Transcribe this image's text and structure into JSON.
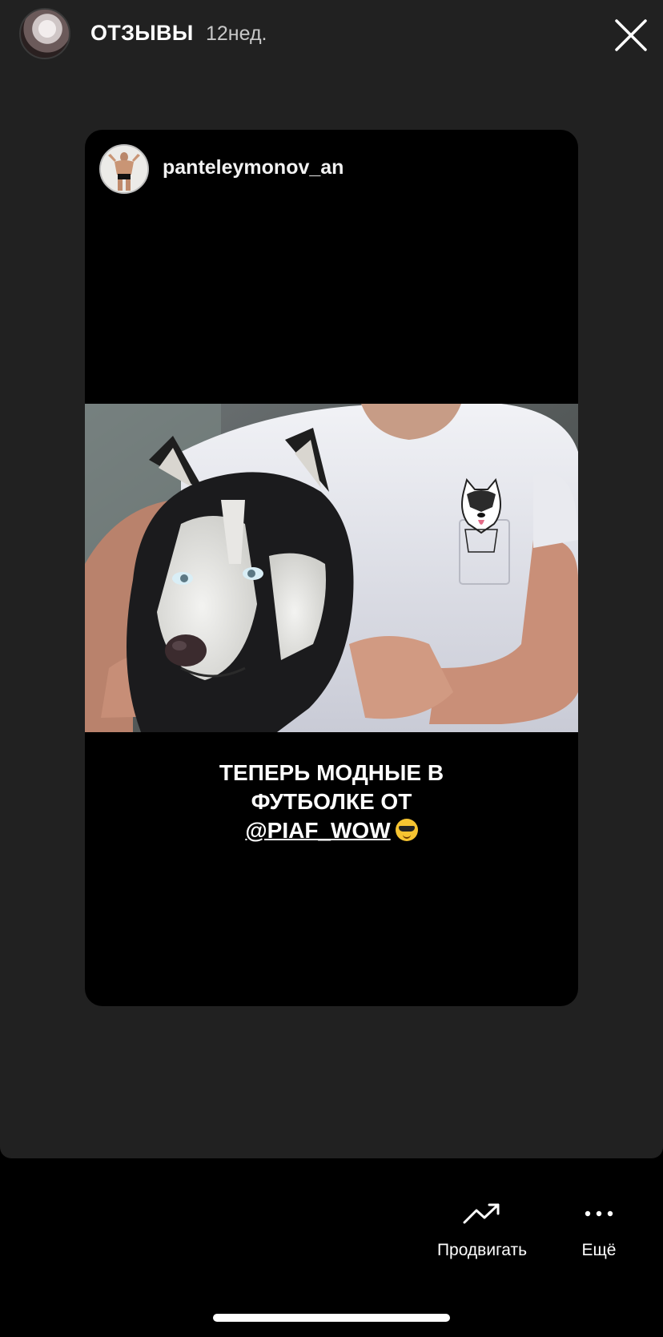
{
  "header": {
    "title": "ОТЗЫВЫ",
    "time": "12нед."
  },
  "post": {
    "username": "panteleymonov_an",
    "caption_line1": "ТЕПЕРЬ МОДНЫЕ В",
    "caption_line2": "ФУТБОЛКЕ ОТ",
    "caption_mention": "@PIAF_WOW",
    "caption_emoji": "😎"
  },
  "footer": {
    "promote_label": "Продвигать",
    "more_label": "Ещё"
  },
  "icons": {
    "close": "close-icon",
    "promote": "trending-up-icon",
    "more": "more-dots-icon"
  }
}
